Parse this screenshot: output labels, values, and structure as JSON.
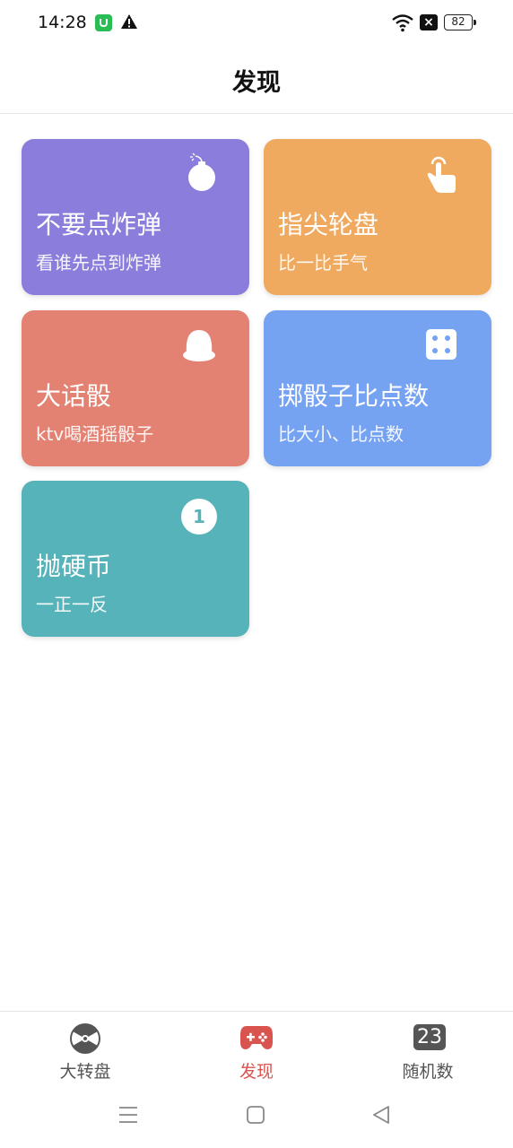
{
  "status_bar": {
    "time": "14:28",
    "battery": "82"
  },
  "header": {
    "title": "发现"
  },
  "cards": [
    {
      "title": "不要点炸弹",
      "subtitle": "看谁先点到炸弹",
      "color": "#8a7ddb",
      "icon": "bomb-icon"
    },
    {
      "title": "指尖轮盘",
      "subtitle": "比一比手气",
      "color": "#f0aa60",
      "icon": "tap-hand-icon"
    },
    {
      "title": "大话骰",
      "subtitle": "ktv喝酒摇骰子",
      "color": "#e38273",
      "icon": "dice-cup-icon"
    },
    {
      "title": "掷骰子比点数",
      "subtitle": "比大小、比点数",
      "color": "#76a2f2",
      "icon": "dice-icon"
    },
    {
      "title": "抛硬币",
      "subtitle": "一正一反",
      "color": "#56b3ba",
      "icon": "coin-icon",
      "icon_text": "1"
    }
  ],
  "tab_bar": {
    "tabs": [
      {
        "label": "大转盘",
        "icon": "wheel-icon",
        "active": false
      },
      {
        "label": "发现",
        "icon": "gamepad-icon",
        "active": true
      },
      {
        "label": "随机数",
        "icon": "random-number-icon",
        "icon_text": "23",
        "active": false
      }
    ]
  },
  "colors": {
    "accent": "#d9534f",
    "tab_inactive": "#555555"
  }
}
